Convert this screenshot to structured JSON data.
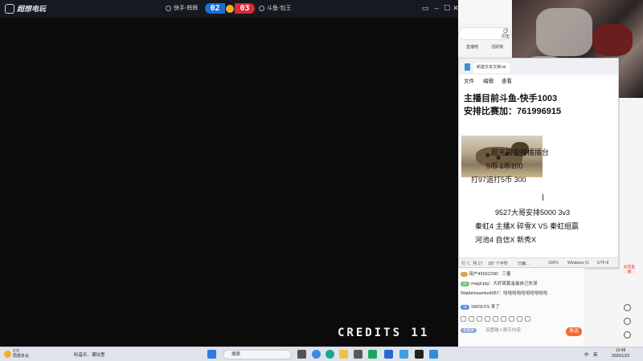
{
  "game": {
    "logo": "超想电玩",
    "team_left": "快手-辉辉",
    "team_right": "斗鱼-包王",
    "score_left": "02",
    "score_right": "03",
    "credits": "CREDITS 11",
    "window_controls": [
      "▭",
      "–",
      "☐",
      "✕"
    ]
  },
  "browser": {
    "history_label": "历史",
    "tabs": [
      "直播榜",
      "活跃榜"
    ]
  },
  "notepad": {
    "tab_title": "新建文本文档.txt",
    "menu": [
      "文件",
      "编辑",
      "查看"
    ],
    "lines": [
      "主播目前斗鱼-快手1003",
      "安排比赛加：761996915",
      "超充周安排擂擂台",
      "5币 1币100",
      "打97追打5币 300",
      "9527大哥安排5000 3v3",
      "秦虹4 主播X 碎雪X VS 秦虹组赢",
      "河池4 自信X 新秀X"
    ],
    "status": {
      "pos": "行 7，列 17",
      "chars": "187 个字符",
      "other": "已编...",
      "zoom": "100%",
      "eol": "Windows (C",
      "enc": "UTF-8"
    }
  },
  "chat": {
    "messages": [
      {
        "badge": "",
        "badge_color": "#e0a050",
        "text": "用户45561298：三量"
      },
      {
        "badge": "16",
        "badge_color": "#6dc06d",
        "text": "magicpig：大好周黄金最自己失误"
      },
      {
        "badge": "",
        "badge_color": "",
        "text": "Waldeinsamkeit087：哈哈哈哈哈哈哈哈哈哈"
      },
      {
        "badge": "16",
        "badge_color": "#4b8fe0",
        "text": "SWOLFS 来了"
      }
    ],
    "input_placeholder": "设置输入聊天内容",
    "login_tag": "未登录",
    "send_label": "发送",
    "side_tag": "抖音直播"
  },
  "taskbar": {
    "temp": "1°C",
    "weather": "局部多云",
    "song": "听音乐、满坑里",
    "search_placeholder": "搜索",
    "time": "13:48",
    "date": "2026/1/23",
    "lang": "中",
    "ime": "英"
  }
}
